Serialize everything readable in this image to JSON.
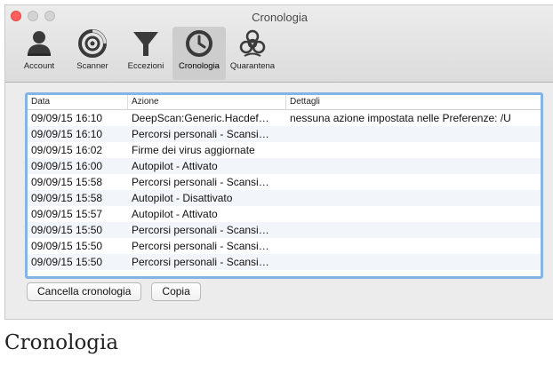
{
  "window": {
    "title": "Cronologia"
  },
  "toolbar": {
    "items": [
      {
        "label": "Account",
        "icon": "account-icon"
      },
      {
        "label": "Scanner",
        "icon": "scanner-icon"
      },
      {
        "label": "Eccezioni",
        "icon": "filter-icon"
      },
      {
        "label": "Cronologia",
        "icon": "clock-icon",
        "active": true
      },
      {
        "label": "Quarantena",
        "icon": "biohazard-icon"
      }
    ]
  },
  "table": {
    "columns": {
      "data": "Data",
      "azione": "Azione",
      "dettagli": "Dettagli"
    },
    "rows": [
      {
        "data": "09/09/15 16:10",
        "azione": "DeepScan:Generic.Hacdef…",
        "dettagli": "nessuna azione impostata nelle Preferenze: /U"
      },
      {
        "data": "09/09/15 16:10",
        "azione": "Percorsi personali - Scansi…",
        "dettagli": ""
      },
      {
        "data": "09/09/15 16:02",
        "azione": "Firme dei virus aggiornate",
        "dettagli": ""
      },
      {
        "data": "09/09/15 16:00",
        "azione": "Autopilot - Attivato",
        "dettagli": ""
      },
      {
        "data": "09/09/15 15:58",
        "azione": "Percorsi personali - Scansi…",
        "dettagli": ""
      },
      {
        "data": "09/09/15 15:58",
        "azione": "Autopilot - Disattivato",
        "dettagli": ""
      },
      {
        "data": "09/09/15 15:57",
        "azione": "Autopilot - Attivato",
        "dettagli": ""
      },
      {
        "data": "09/09/15 15:50",
        "azione": "Percorsi personali - Scansi…",
        "dettagli": ""
      },
      {
        "data": "09/09/15 15:50",
        "azione": "Percorsi personali - Scansi…",
        "dettagli": ""
      },
      {
        "data": "09/09/15 15:50",
        "azione": "Percorsi personali - Scansi…",
        "dettagli": ""
      }
    ]
  },
  "buttons": {
    "clear": "Cancella cronologia",
    "copy": "Copia"
  },
  "caption": "Cronologia",
  "colors": {
    "accent": "#84b3e6",
    "close": "#fc605c"
  }
}
